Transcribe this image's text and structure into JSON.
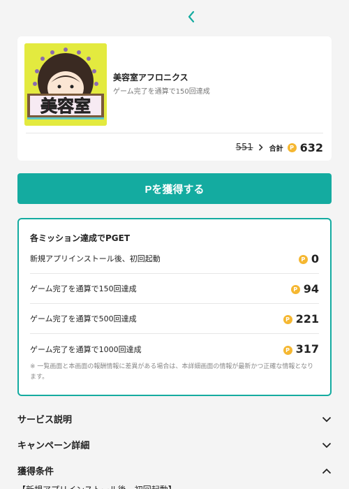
{
  "nav": {
    "back_icon": "chevron-left-icon"
  },
  "app": {
    "name": "美容室アフロニクス",
    "condition": "ゲーム完了を通算で150回達成",
    "icon_text": "美容室",
    "icon_bg": "#e3ea3f"
  },
  "price": {
    "old": "551",
    "total_label": "合計",
    "coin_symbol": "P",
    "total": "632"
  },
  "cta": {
    "label": "Pを獲得する",
    "color": "#14aba0"
  },
  "missions": {
    "title": "各ミッション達成でPGET",
    "items": [
      {
        "label": "新規アプリインストール後、初回起動",
        "points": "0"
      },
      {
        "label": "ゲーム完了を通算で150回達成",
        "points": "94"
      },
      {
        "label": "ゲーム完了を通算で500回達成",
        "points": "221"
      },
      {
        "label": "ゲーム完了を通算で1000回達成",
        "points": "317"
      }
    ],
    "note": "※ 一覧画面と本画面の報酬情報に差異がある場合は、本詳細画面の情報が最新かつ正確な情報となります。"
  },
  "sections": [
    {
      "label": "サービス説明",
      "state": "collapsed"
    },
    {
      "label": "キャンペーン詳細",
      "state": "collapsed"
    },
    {
      "label": "獲得条件",
      "state": "expanded"
    }
  ],
  "conditions_first_line": "【新規アプリインストール後、初回起動】"
}
